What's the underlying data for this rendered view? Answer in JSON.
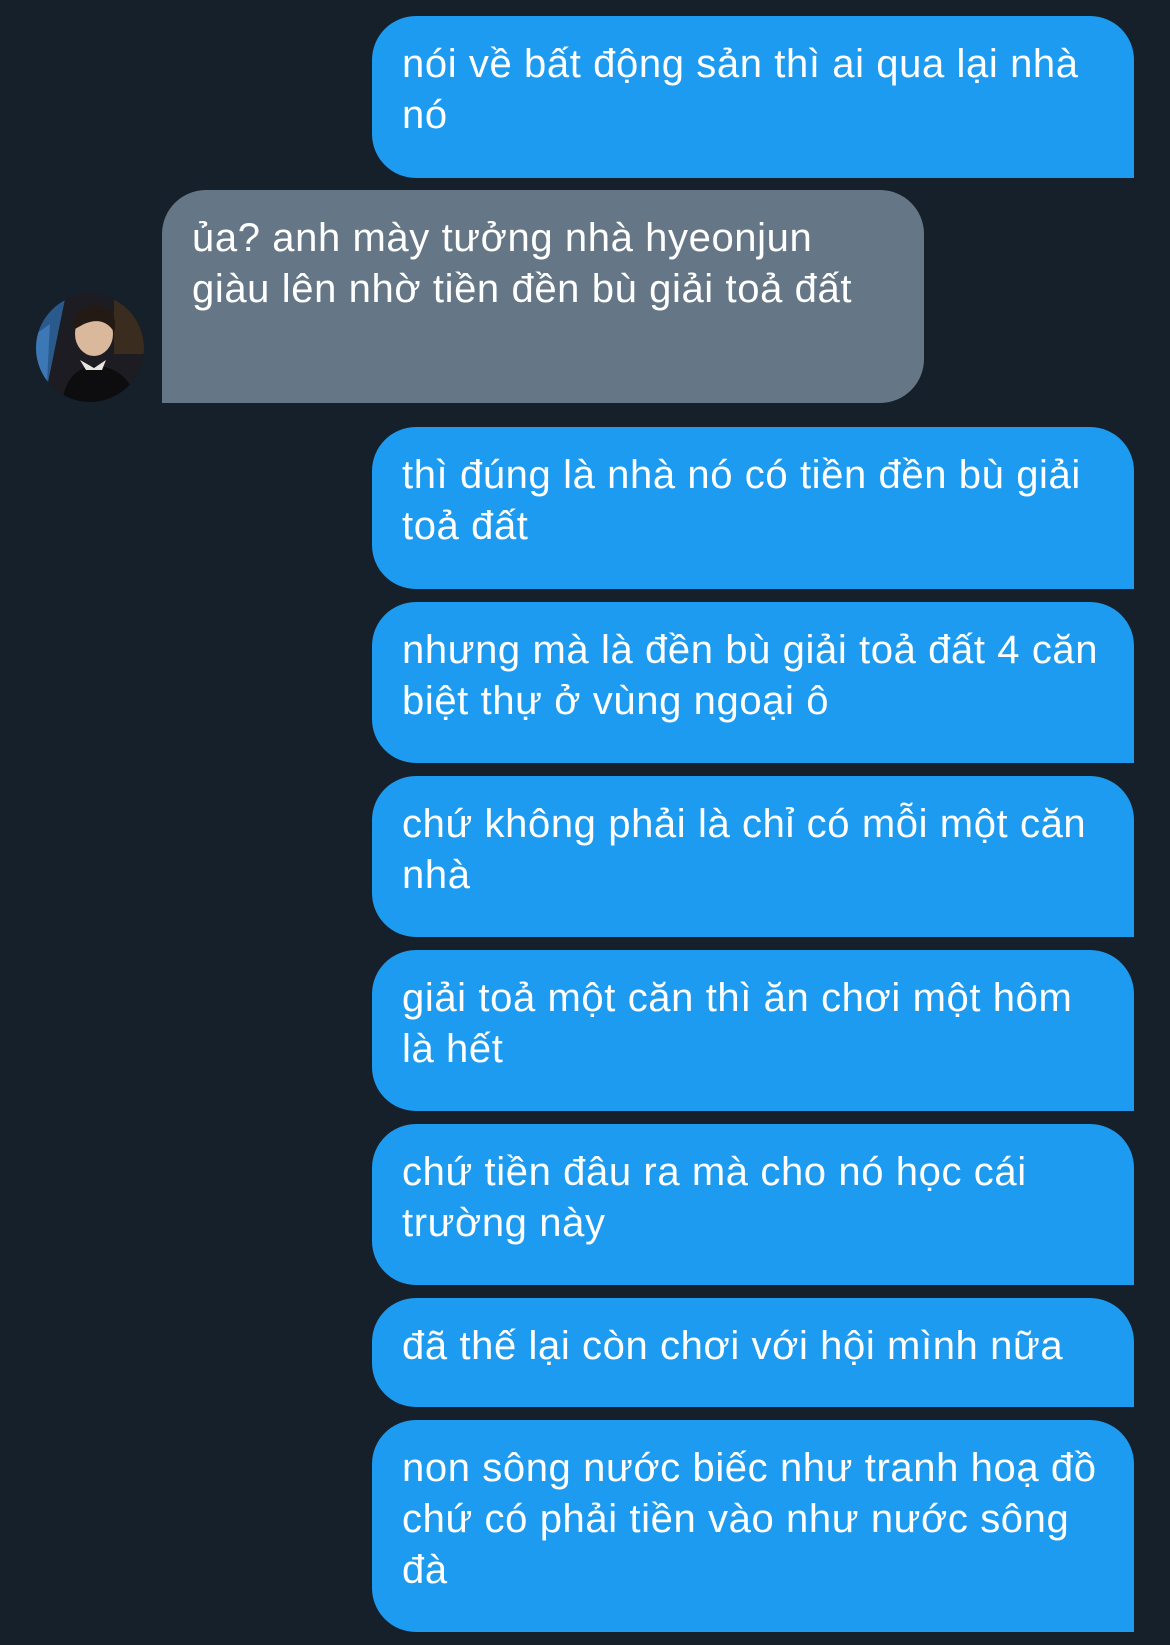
{
  "conversation": {
    "messages": [
      {
        "direction": "sent",
        "text": "nói về bất động sản thì ai qua lại nhà nó"
      },
      {
        "direction": "received",
        "text": "ủa? anh mày tưởng nhà hyeonjun giàu lên nhờ tiền đền bù giải toả đất"
      },
      {
        "direction": "sent",
        "text": "thì đúng là nhà nó có tiền đền bù giải toả đất"
      },
      {
        "direction": "sent",
        "text": "nhưng mà là đền bù giải toả đất 4 căn biệt thự ở vùng ngoại ô"
      },
      {
        "direction": "sent",
        "text": "chứ không phải là chỉ có mỗi một căn nhà"
      },
      {
        "direction": "sent",
        "text": "giải toả một căn thì ăn chơi một hôm là hết"
      },
      {
        "direction": "sent",
        "text": "chứ tiền đâu ra mà cho nó học cái trường này"
      },
      {
        "direction": "sent",
        "text": "đã thế lại còn chơi với hội mình nữa"
      },
      {
        "direction": "sent",
        "text": "non sông nước biếc như tranh hoạ đồ chứ có phải tiền vào như nước sông đà"
      }
    ]
  },
  "colors": {
    "background": "#15202b",
    "sent_bubble": "#1d9bf0",
    "received_bubble": "#657786",
    "text": "#ffffff"
  },
  "icons": {
    "avatar": "contact-avatar-photo"
  }
}
